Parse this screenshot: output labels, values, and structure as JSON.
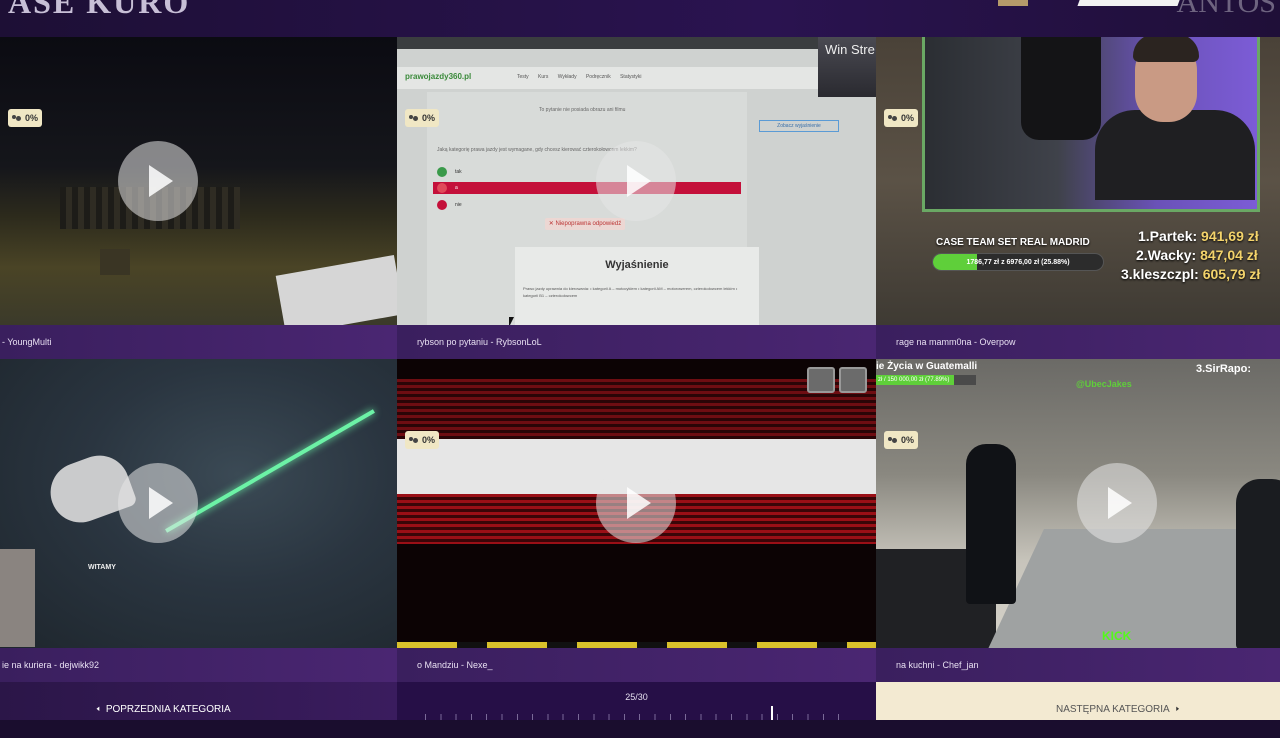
{
  "header": {
    "title": "ASE KURO",
    "logo_right": "ANTOS"
  },
  "tiles": [
    {
      "caption": "- YoungMulti",
      "viewers": "0%"
    },
    {
      "caption": "rybson po pytaniu - RybsonLoL",
      "viewers": "0%"
    },
    {
      "caption": "rage na mamm0na - Overpow",
      "viewers": "0%"
    },
    {
      "caption": "ie na kuriera - dejwikk92",
      "viewers": "0%"
    },
    {
      "caption": "o Mandziu - Nexe_",
      "viewers": "0%"
    },
    {
      "caption": "na kuchni - Chef_jan",
      "viewers": "0%"
    }
  ],
  "web": {
    "logo": "prawojazdy360.pl",
    "nav": "Testy Kurs Wykłady Podręcznik Statystyki",
    "question": "Jaką kategorię prawa jazdy jest wymagane, gdy chcesz kierować czterokołowcem lekkim?",
    "opt_a": "tak",
    "opt_b": "a",
    "opt_c": "nie",
    "wrong_answer": "✕ Niepoprawna odpowiedź",
    "explanation_title": "Wyjaśnienie",
    "explanation_text": "Prawo jazdy uprawnia do kierowania: • kategorii A – motocyklem • kategorii AM – motorowerem, czterokołowcem lekkim • kategorii B1 – czterokołowcem",
    "show_explanation": "Zobacz wyjaśnienie",
    "no_video": "To pytanie nie posiada obrazu ani filmu",
    "cam_text": "Win Stre"
  },
  "cam3": {
    "goal_title": "CASE TEAM SET REAL MADRID",
    "goal_text": "1786,77 zł z 6976,00 zł (25.88%)",
    "goal_progress": 0.2588,
    "leaderboard": [
      {
        "rank": "1.Partek:",
        "amount": "941,69 zł"
      },
      {
        "rank": "2.Wacky:",
        "amount": "847,04 zł"
      },
      {
        "rank": "3.kleszczpl:",
        "amount": "605,79 zł"
      }
    ]
  },
  "lol": {
    "overlay": "WITAMY"
  },
  "kitchen": {
    "top_text": "ie Życia w Guatemalli",
    "bar_text": "zł / 150 000,00 zł (77.89%)",
    "bar_progress": 0.7789,
    "rank": "3.SirRapo:",
    "tag": "@UbecJakes",
    "kick": "KICK"
  },
  "nav": {
    "prev_label": "POPRZEDNIA KATEGORIA",
    "page": "25/30",
    "next_label": "NASTĘPNA KATEGORIA"
  },
  "colors": {
    "accent_purple": "#3a1f5e",
    "badge": "#f0e7c4",
    "gold": "#f3d36b",
    "green": "#5fcf3a"
  }
}
